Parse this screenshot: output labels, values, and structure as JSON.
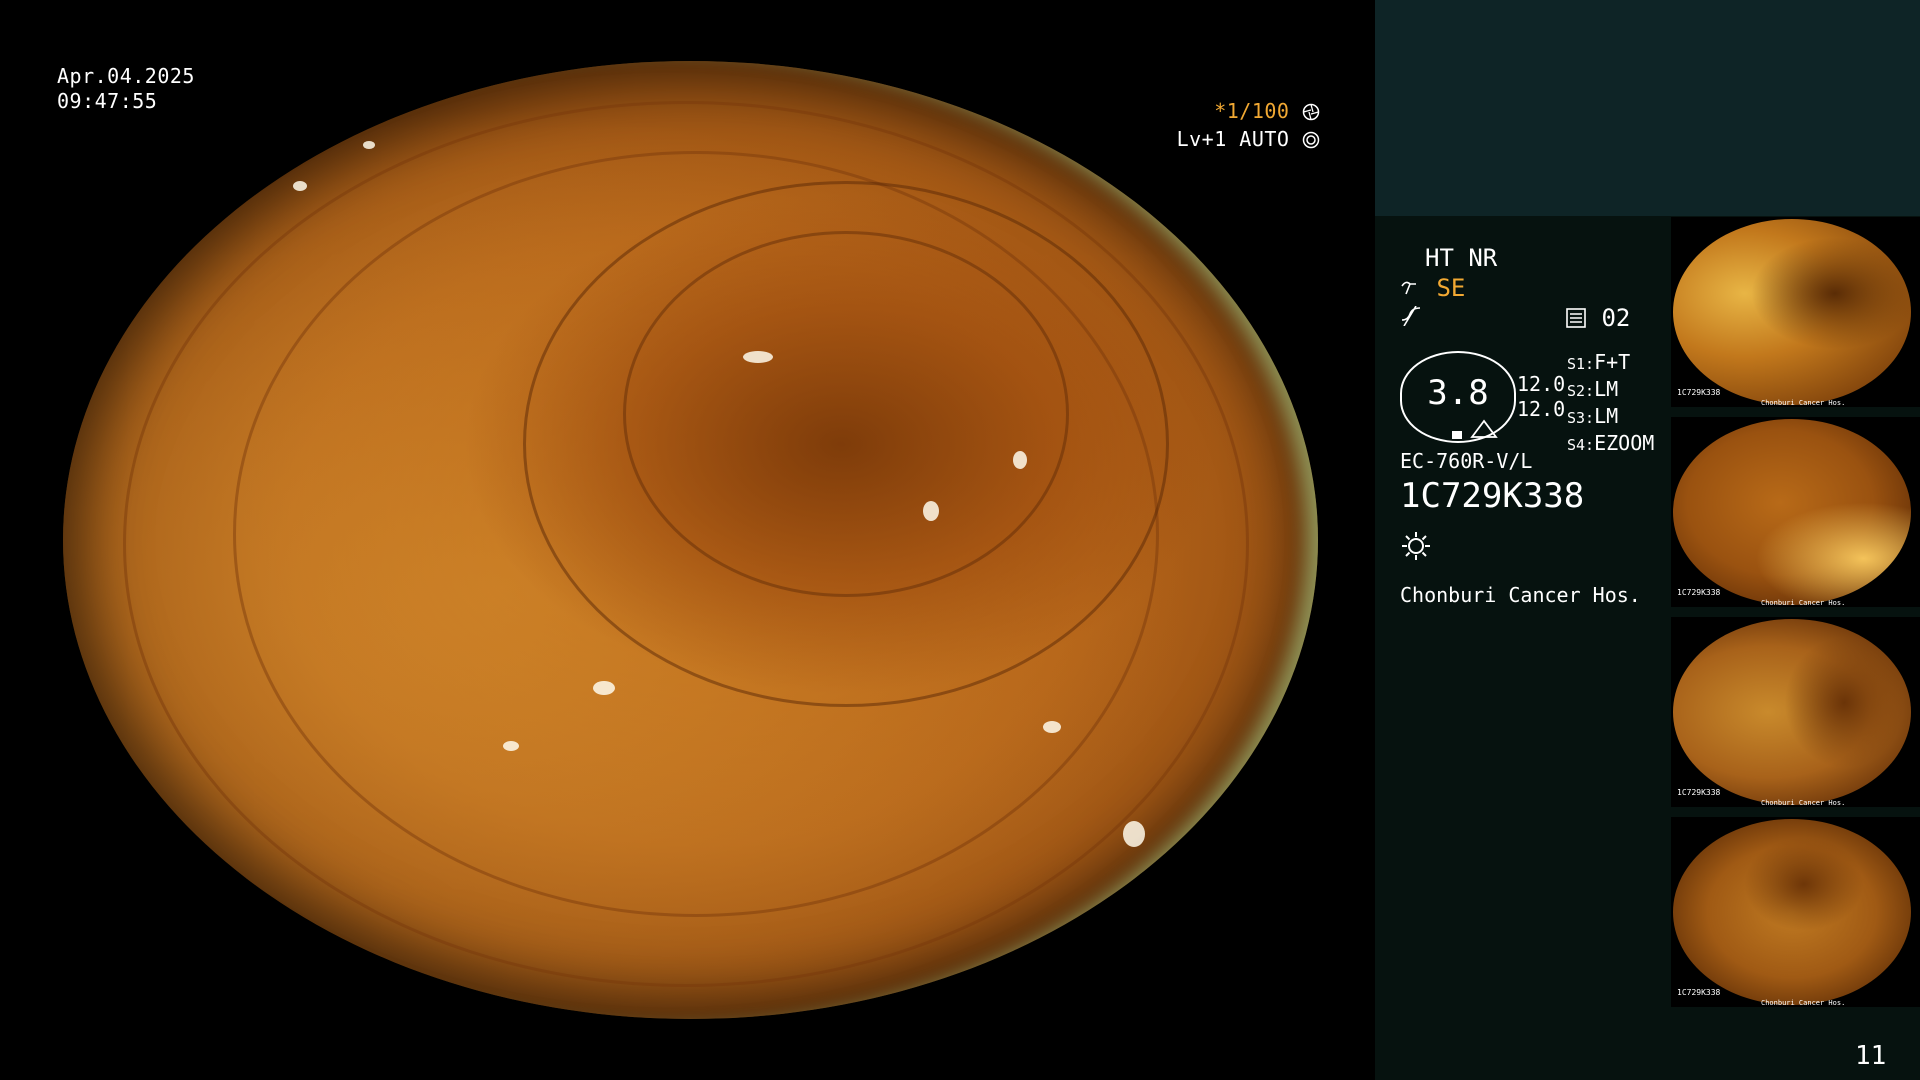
{
  "overlay": {
    "date": "Apr.04.2025",
    "time": "09:47:55",
    "shutter": "*1/100",
    "shutter_icon": "aperture-icon",
    "light_mode": "Lv+1 AUTO",
    "light_icon": "iris-icon"
  },
  "info": {
    "mode_line": "HT NR",
    "enhance_icon": "structure-enhance-icon",
    "enhance_mode": "SE",
    "color_icon": "color-curve-icon",
    "memory_icon": "memory-card-icon",
    "memory_count": "02",
    "zoom_value": "3.8",
    "focus_top": "12.0",
    "focus_bottom": "12.0",
    "switches": [
      {
        "key": "S1:",
        "value": "F+T"
      },
      {
        "key": "S2:",
        "value": "LM"
      },
      {
        "key": "S3:",
        "value": "LM"
      },
      {
        "key": "S4:",
        "value": "EZOOM"
      }
    ],
    "scope_model": "EC-760R-V/L",
    "scope_serial": "1C729K338",
    "light_icon": "sun-icon",
    "hospital": "Chonburi Cancer Hos."
  },
  "thumbnails": [
    {
      "serial": "1C729K338",
      "footer": "Chonburi Cancer Hos."
    },
    {
      "serial": "1C729K338",
      "footer": "Chonburi Cancer Hos."
    },
    {
      "serial": "1C729K338",
      "footer": "Chonburi Cancer Hos."
    },
    {
      "serial": "1C729K338",
      "footer": "Chonburi Cancer Hos."
    }
  ],
  "page_number": "11",
  "colors": {
    "panel_bg": "#06120f",
    "panel_top_bg": "#0e2426",
    "accent_yellow": "#f2a933"
  }
}
